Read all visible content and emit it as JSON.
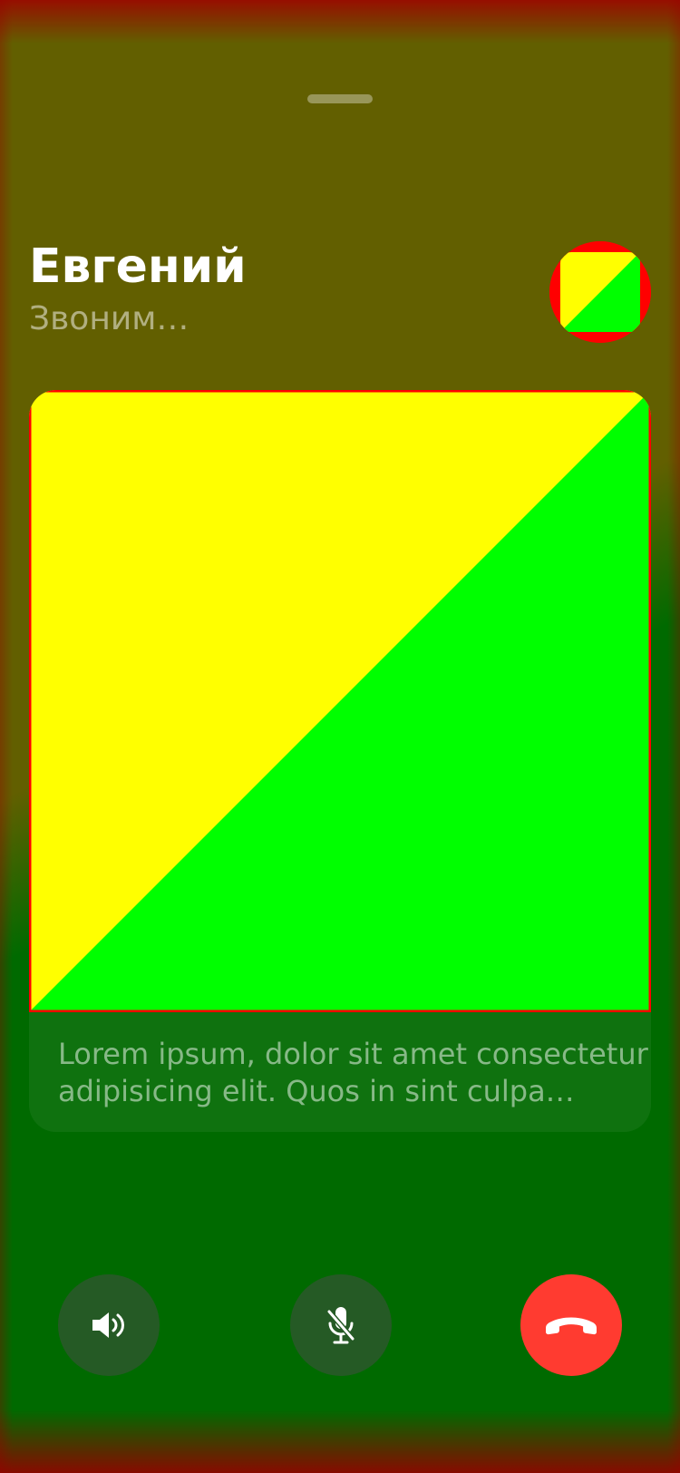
{
  "call": {
    "caller_name": "Евгений",
    "status_text": "Звоним…"
  },
  "message": {
    "line1": "Lorem ipsum, dolor sit amet consectetur",
    "line2": "adipisicing elit. Quos in sint culpa…"
  },
  "controls": [
    {
      "name": "speaker-button",
      "icon": "speaker-icon"
    },
    {
      "name": "mute-button",
      "icon": "microphone-off-icon"
    },
    {
      "name": "end-call-button",
      "icon": "phone-hangup-icon"
    }
  ],
  "colors": {
    "background_top": "#625f00",
    "background_bottom": "#006a00",
    "edge_tint": "#a00000",
    "image_yellow": "#ffff00",
    "image_green": "#00ff00",
    "image_border": "#ff0000",
    "control_bg": "#255a25",
    "hangup_red": "#ff3b30",
    "text_primary": "#ffffff"
  }
}
